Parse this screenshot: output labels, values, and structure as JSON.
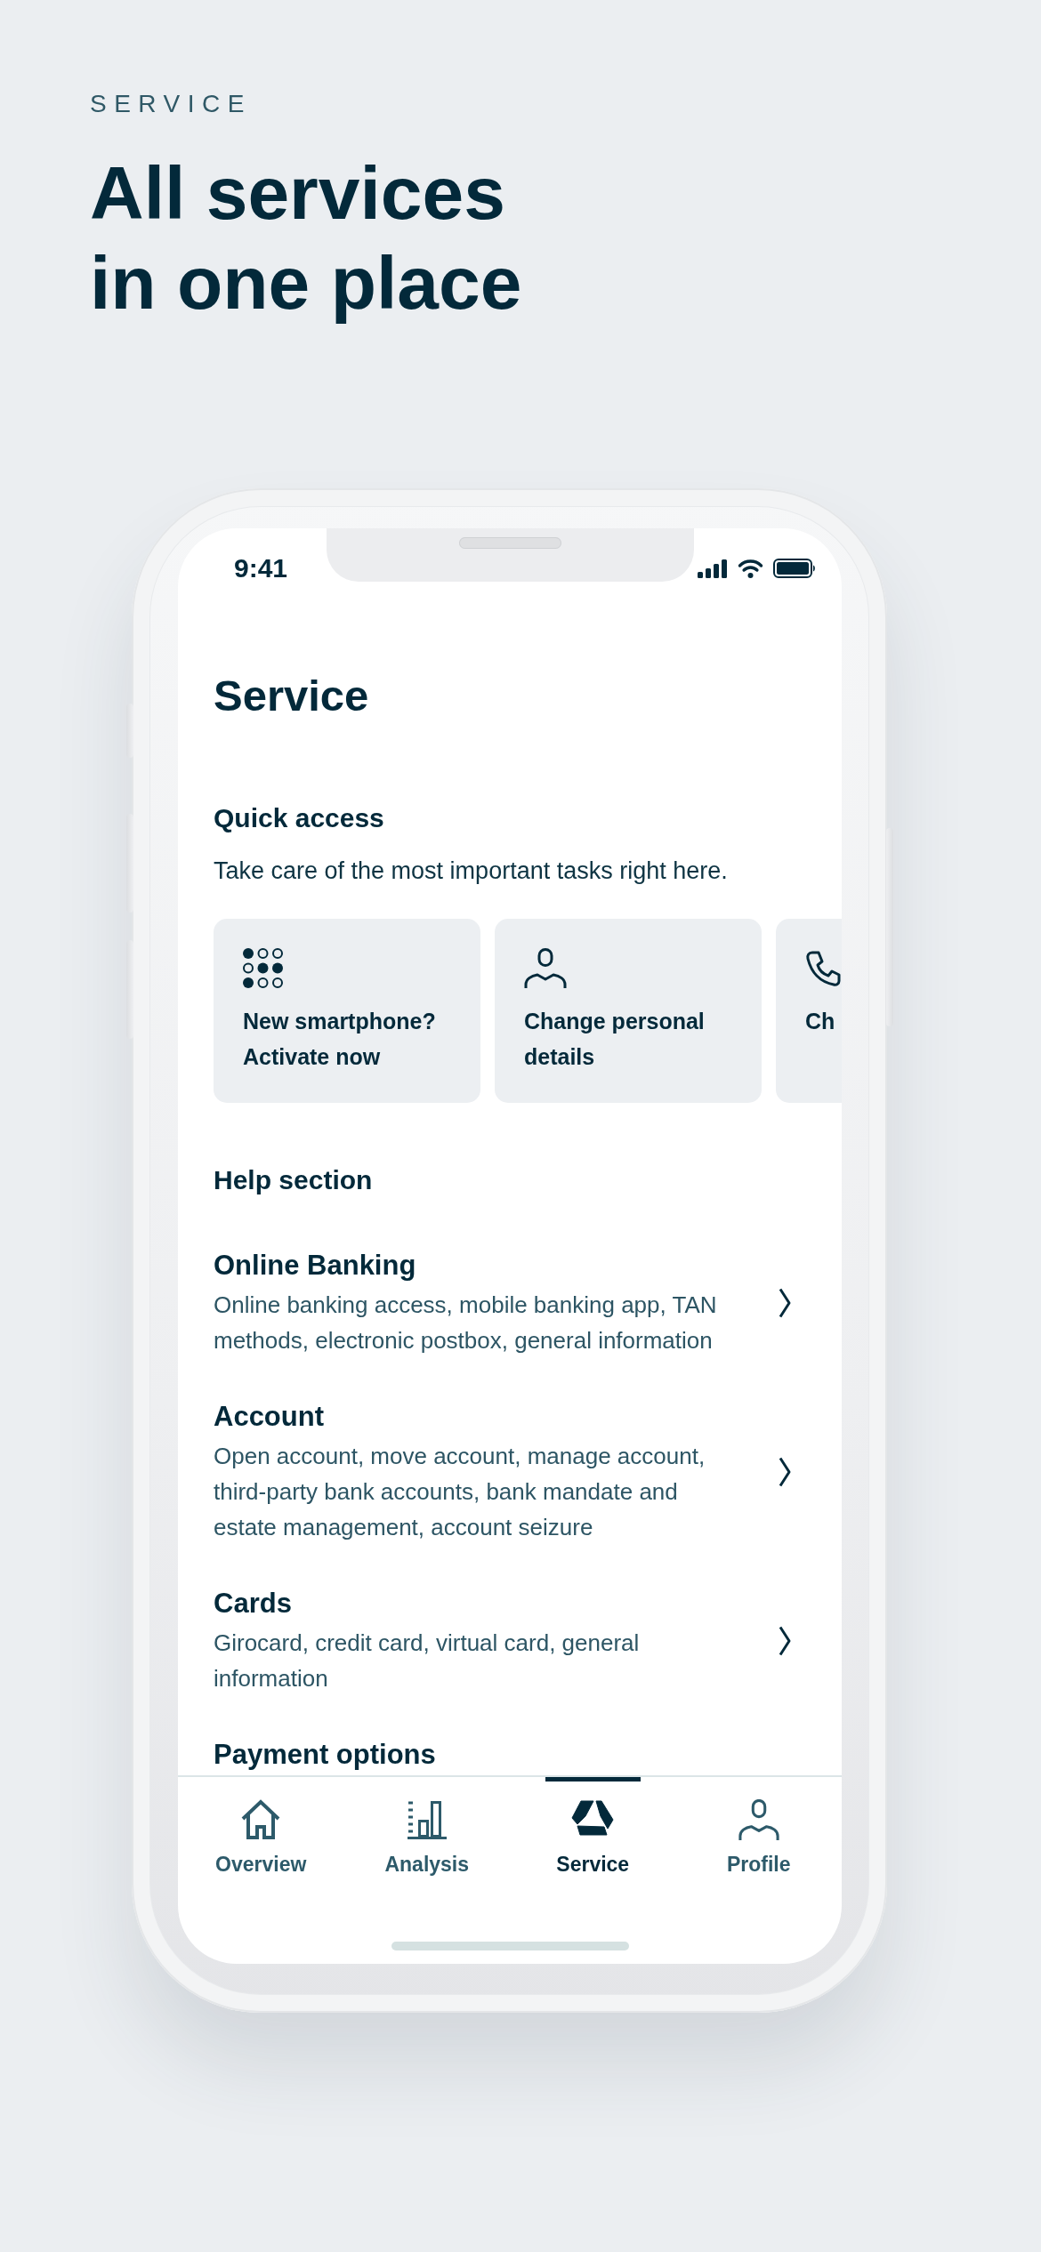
{
  "header": {
    "eyebrow": "SERVICE",
    "headline": "All services in one place"
  },
  "phone": {
    "status_bar": {
      "time": "9:41"
    },
    "page_title": "Service",
    "quick_access": {
      "title": "Quick access",
      "description": "Take care of the most important tasks right here.",
      "cards": [
        {
          "label": "New smartphone? Activate now"
        },
        {
          "label": "Change personal details"
        },
        {
          "label": "Ch"
        }
      ]
    },
    "help_section": {
      "title": "Help section",
      "items": [
        {
          "title": "Online Banking",
          "description": "Online banking access, mobile banking app, TAN methods, electronic postbox, general information"
        },
        {
          "title": "Account",
          "description": "Open account, move account, manage account, third-party bank accounts, bank mandate and estate management, account seizure"
        },
        {
          "title": "Cards",
          "description": "Girocard, credit card, virtual card, general information"
        },
        {
          "title": "Payment options"
        }
      ]
    },
    "tab_bar": {
      "tabs": [
        {
          "label": "Overview",
          "selected": false
        },
        {
          "label": "Analysis",
          "selected": false
        },
        {
          "label": "Service",
          "selected": true
        },
        {
          "label": "Profile",
          "selected": false
        }
      ]
    }
  }
}
